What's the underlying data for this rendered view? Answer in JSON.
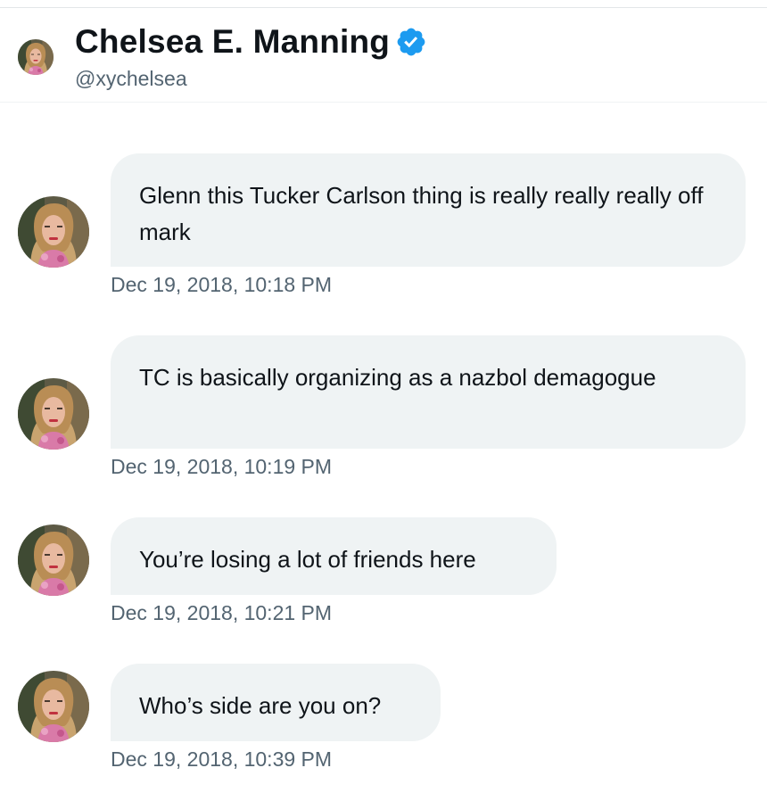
{
  "header": {
    "display_name": "Chelsea E. Manning",
    "handle": "@xychelsea",
    "verified": true,
    "verified_color": "#1d9bf0"
  },
  "messages": [
    {
      "text": "Glenn this Tucker Carlson thing is really really really off mark",
      "timestamp": "Dec 19, 2018, 10:18 PM"
    },
    {
      "text": "TC is basically organizing as a nazbol demagogue",
      "timestamp": "Dec 19, 2018, 10:19 PM"
    },
    {
      "text": "You’re losing a lot of friends here",
      "timestamp": "Dec 19, 2018, 10:21 PM"
    },
    {
      "text": "Who’s side are you on?",
      "timestamp": "Dec 19, 2018, 10:39 PM"
    }
  ],
  "colors": {
    "bubble_bg": "#eff3f4",
    "secondary_text": "#536471",
    "primary_text": "#0f1419"
  },
  "icons": {
    "verified": "verified-badge-icon",
    "avatar": "profile-photo"
  }
}
